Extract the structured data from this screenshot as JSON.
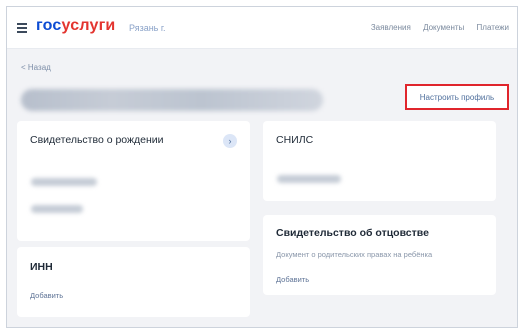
{
  "header": {
    "logo_part1": "гос",
    "logo_part2": "услуги",
    "city": "Рязань г.",
    "nav": [
      "Заявления",
      "Документы",
      "Платежи"
    ]
  },
  "page": {
    "back_link": "< Назад",
    "configure_profile": "Настроить профиль"
  },
  "cards": {
    "birth_certificate": {
      "title": "Свидетельство о рождении"
    },
    "snils": {
      "title": "СНИЛС"
    },
    "inn": {
      "title": "ИНН",
      "action": "Добавить"
    },
    "paternity": {
      "title": "Свидетельство об отцовстве",
      "subtitle": "Документ о родительских правах на ребёнка",
      "action": "Добавить"
    }
  },
  "icons": {
    "chevron": "chevron-right-icon",
    "menu": "hamburger-menu-icon"
  },
  "colors": {
    "brand_blue": "#0d4cd3",
    "brand_red": "#e3342f",
    "highlight_red": "#e0252c"
  }
}
